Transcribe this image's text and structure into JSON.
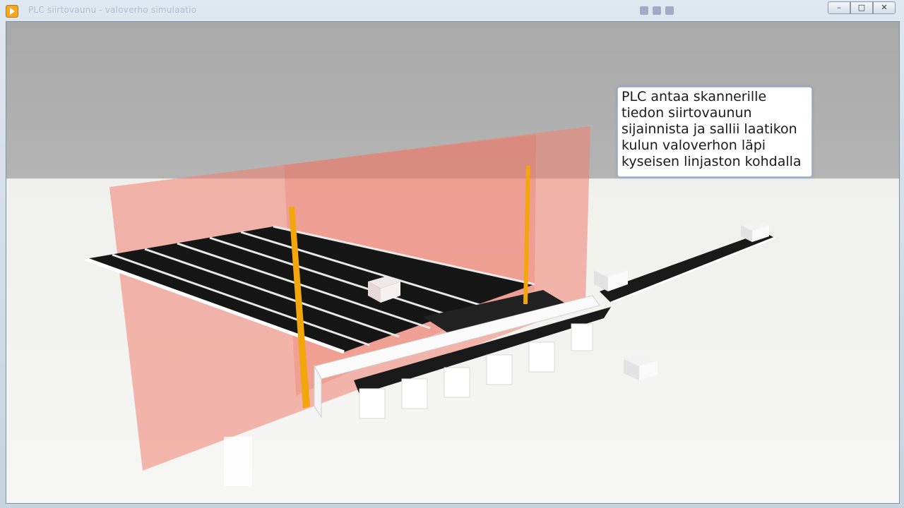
{
  "window": {
    "title": "PLC siirtovaunu - valoverho simulaatio",
    "buttons": {
      "minimize": "–",
      "maximize": "□",
      "close": "✕"
    }
  },
  "callout": {
    "text": "PLC antaa skannerille tiedon siirtovaunun sijainnista ja sallii laatikon kulun valoverhon läpi kyseisen linjaston kohdalla"
  },
  "colors": {
    "light_curtain": "#f08070",
    "conveyor_belt": "#1a1a1a",
    "pillar": "#f2a60c",
    "frame": "#ffffff",
    "callout_border": "#9fc2e8"
  },
  "icons": [
    "app-icon",
    "minimize-icon",
    "maximize-icon",
    "close-icon"
  ]
}
